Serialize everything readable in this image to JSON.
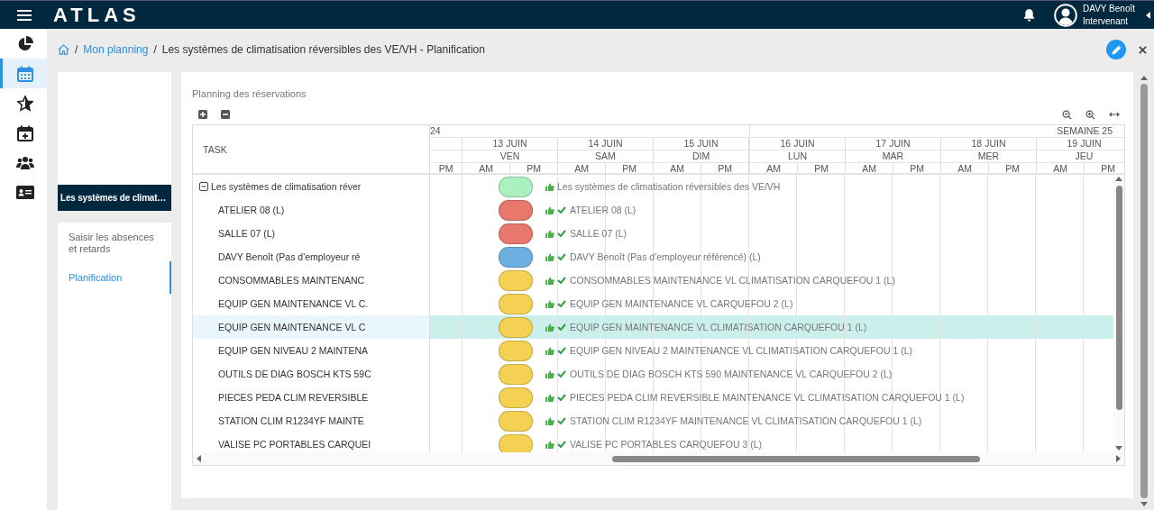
{
  "app": {
    "logo": "ATLAS",
    "user_name": "DAVY Benoît",
    "user_role": "Intervenant"
  },
  "nav": [
    {
      "kind": "pie",
      "selected": false
    },
    {
      "kind": "calendar",
      "selected": true
    },
    {
      "kind": "star",
      "selected": false
    },
    {
      "kind": "calendar-plus",
      "selected": false
    },
    {
      "kind": "users",
      "selected": false
    },
    {
      "kind": "id-card",
      "selected": false
    }
  ],
  "breadcrumb": {
    "separators": [
      "/",
      "/"
    ],
    "link": "Mon planning",
    "current": "Les systèmes de climatisation réversibles des VE/VH - Planification"
  },
  "side_panel": {
    "tab": "Les systèmes de climat…",
    "items": [
      {
        "label": "Saisir les absences et retards",
        "selected": false
      },
      {
        "label": "Planification",
        "selected": true
      }
    ]
  },
  "planning": {
    "title": "Planning des réservations",
    "task_header": "TASK",
    "weeks": [
      {
        "label": "24",
        "lead_halves": [
          "PM"
        ],
        "days": [
          {
            "date": "13 JUIN",
            "weekday": "VEN",
            "halves": [
              "AM",
              "PM"
            ]
          },
          {
            "date": "14 JUIN",
            "weekday": "SAM",
            "halves": [
              "AM",
              "PM"
            ]
          },
          {
            "date": "15 JUIN",
            "weekday": "DIM",
            "halves": [
              "AM",
              "PM"
            ]
          }
        ]
      },
      {
        "label": "SEMAINE 25",
        "days": [
          {
            "date": "16 JUIN",
            "weekday": "LUN",
            "halves": [
              "AM",
              "PM"
            ]
          },
          {
            "date": "17 JUIN",
            "weekday": "MAR",
            "halves": [
              "AM",
              "PM"
            ]
          },
          {
            "date": "18 JUIN",
            "weekday": "MER",
            "halves": [
              "AM",
              "PM"
            ]
          },
          {
            "date": "19 JUIN",
            "weekday": "JEU",
            "halves": [
              "AM",
              "PM"
            ]
          }
        ]
      }
    ],
    "rows": [
      {
        "kind": "group",
        "expanded": true,
        "task": "Les systèmes de climatisation réver",
        "color": "#aaf0c1",
        "confirmed": false,
        "label": "Les systèmes de climatisation réversibles des VE/VH",
        "selected": false
      },
      {
        "kind": "item",
        "task": "ATELIER 08 (L)",
        "color": "#e8786c",
        "confirmed": true,
        "label": "ATELIER 08 (L)",
        "selected": false
      },
      {
        "kind": "item",
        "task": "SALLE 07 (L)",
        "color": "#e8786c",
        "confirmed": true,
        "label": "SALLE 07 (L)",
        "selected": false
      },
      {
        "kind": "item",
        "task": "DAVY Benoît (Pas d'employeur ré",
        "color": "#6cb0e2",
        "confirmed": true,
        "label": "DAVY Benoît (Pas d'employeur référencé) (L)",
        "selected": false
      },
      {
        "kind": "item",
        "task": "CONSOMMABLES MAINTENANC",
        "color": "#f4d152",
        "confirmed": true,
        "label": "CONSOMMABLES MAINTENANCE VL CLIMATISATION CARQUEFOU 1 (L)",
        "selected": false
      },
      {
        "kind": "item",
        "task": "EQUIP GEN MAINTENANCE VL C.",
        "color": "#f4d152",
        "confirmed": true,
        "label": "EQUIP GEN MAINTENANCE VL CARQUEFOU 2 (L)",
        "selected": false
      },
      {
        "kind": "item",
        "task": "EQUIP GEN MAINTENANCE VL C",
        "color": "#f4d152",
        "confirmed": true,
        "label": "EQUIP GEN MAINTENANCE VL CLIMATISATION CARQUEFOU 1 (L)",
        "selected": true
      },
      {
        "kind": "item",
        "task": "EQUIP GEN NIVEAU 2 MAINTENA",
        "color": "#f4d152",
        "confirmed": true,
        "label": "EQUIP GEN NIVEAU 2 MAINTENANCE VL CLIMATISATION CARQUEFOU 1 (L)",
        "selected": false
      },
      {
        "kind": "item",
        "task": "OUTILS DE DIAG BOSCH KTS 59C",
        "color": "#f4d152",
        "confirmed": true,
        "label": "OUTILS DE DIAG BOSCH KTS 590 MAINTENANCE VL CARQUEFOU 2 (L)",
        "selected": false
      },
      {
        "kind": "item",
        "task": "PIECES PEDA CLIM REVERSIBLE",
        "color": "#f4d152",
        "confirmed": true,
        "label": "PIECES PEDA CLIM REVERSIBLE MAINTENANCE VL CLIMATISATION CARQUEFOU 1 (L)",
        "selected": false
      },
      {
        "kind": "item",
        "task": "STATION CLIM R1234YF MAINTE",
        "color": "#f4d152",
        "confirmed": true,
        "label": "STATION CLIM R1234YF MAINTENANCE VL CLIMATISATION CARQUEFOU 1 (L)",
        "selected": false
      },
      {
        "kind": "item",
        "task": "VALISE PC PORTABLES CARQUEI",
        "color": "#f4d152",
        "confirmed": true,
        "label": "VALISE PC PORTABLES CARQUEFOU 3 (L)",
        "selected": false
      }
    ]
  }
}
